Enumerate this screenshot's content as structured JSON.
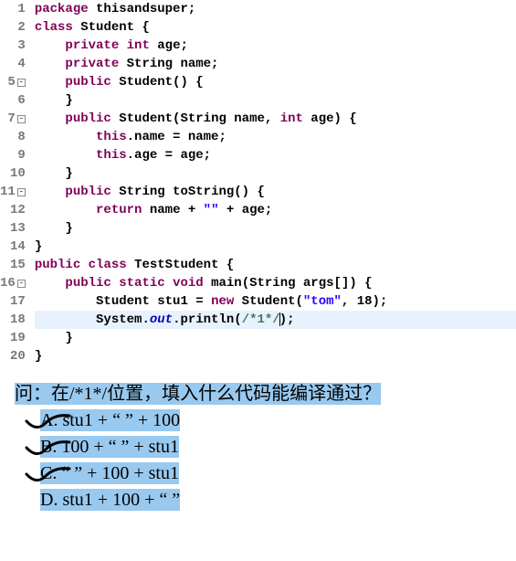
{
  "code": {
    "lines": [
      {
        "num": "1",
        "fold": false,
        "html": "<span class='kw'>package</span> <span class='plain'>thisandsuper;</span>"
      },
      {
        "num": "2",
        "fold": false,
        "html": "<span class='kw'>class</span> <span class='plain'>Student {</span>"
      },
      {
        "num": "3",
        "fold": false,
        "html": "    <span class='kw'>private</span> <span class='kw'>int</span> <span class='plain'>age;</span>"
      },
      {
        "num": "4",
        "fold": false,
        "html": "    <span class='kw'>private</span> <span class='plain'>String name;</span>"
      },
      {
        "num": "5",
        "fold": true,
        "html": "    <span class='kw'>public</span> <span class='plain'>Student() {</span>"
      },
      {
        "num": "6",
        "fold": false,
        "html": "    <span class='plain'>}</span>"
      },
      {
        "num": "7",
        "fold": true,
        "html": "    <span class='kw'>public</span> <span class='plain'>Student(String name, </span><span class='kw'>int</span><span class='plain'> age) {</span>"
      },
      {
        "num": "8",
        "fold": false,
        "html": "        <span class='kw'>this</span><span class='plain'>.name = name;</span>"
      },
      {
        "num": "9",
        "fold": false,
        "html": "        <span class='kw'>this</span><span class='plain'>.age = age;</span>"
      },
      {
        "num": "10",
        "fold": false,
        "html": "    <span class='plain'>}</span>"
      },
      {
        "num": "11",
        "fold": true,
        "html": "    <span class='kw'>public</span> <span class='plain'>String toString() {</span>"
      },
      {
        "num": "12",
        "fold": false,
        "html": "        <span class='kw'>return</span> <span class='plain'>name + </span><span class='str'>\"\"</span><span class='plain'> + age;</span>"
      },
      {
        "num": "13",
        "fold": false,
        "html": "    <span class='plain'>}</span>"
      },
      {
        "num": "14",
        "fold": false,
        "html": "<span class='plain'>}</span>"
      },
      {
        "num": "15",
        "fold": false,
        "html": "<span class='kw'>public</span> <span class='kw'>class</span> <span class='plain'>TestStudent {</span>"
      },
      {
        "num": "16",
        "fold": true,
        "html": "    <span class='kw'>public</span> <span class='kw'>static</span> <span class='kw'>void</span> <span class='plain'>main(String args[]) {</span>"
      },
      {
        "num": "17",
        "fold": false,
        "html": "        <span class='plain'>Student stu1 = </span><span class='kw'>new</span><span class='plain'> Student(</span><span class='str'>\"tom\"</span><span class='plain'>, 18);</span>"
      },
      {
        "num": "18",
        "fold": false,
        "highlight": true,
        "html": "        <span class='plain'>System.</span><span class='static-field'>out</span><span class='plain'>.println(</span><span class='comment'>/*1*/</span><span class='cursor-caret'></span><span class='plain'>);</span>"
      },
      {
        "num": "19",
        "fold": false,
        "html": "    <span class='plain'>}</span>"
      },
      {
        "num": "20",
        "fold": false,
        "html": "<span class='plain'>}</span>"
      }
    ]
  },
  "question": {
    "prompt": "问：在/*1*/位置，填入什么代码能编译通过？",
    "options": [
      {
        "label": "A.",
        "text": "stu1 + \" \" + 100",
        "marked": true
      },
      {
        "label": "B.",
        "text": "100 + \" \"  + stu1",
        "marked": true
      },
      {
        "label": "C.",
        "text": "\" \" + 100 + stu1",
        "marked": true
      },
      {
        "label": "D.",
        "text": "stu1 + 100 + \" \"",
        "marked": false
      }
    ]
  }
}
